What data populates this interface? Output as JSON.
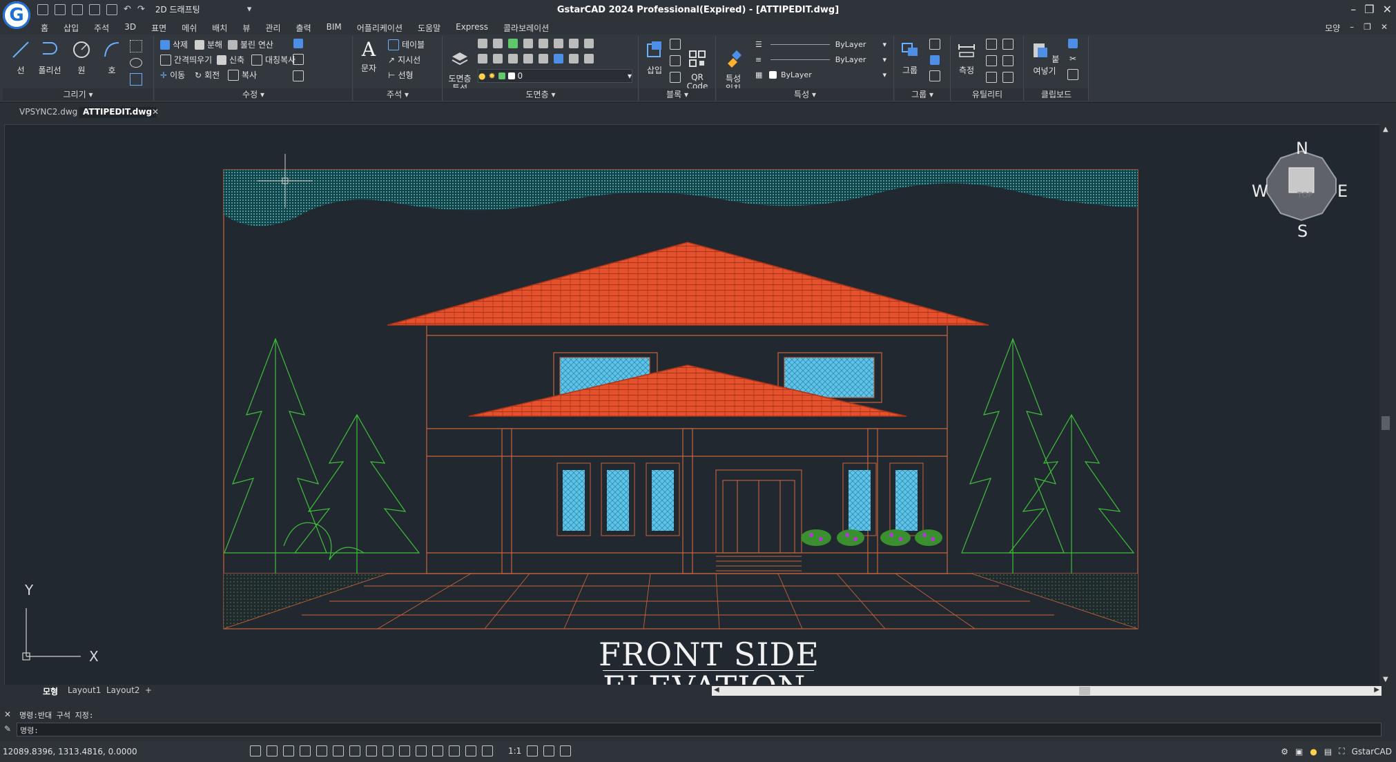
{
  "titlebar": {
    "workspace": "2D 드래프팅",
    "title": "GstarCAD 2024 Professional(Expired) - [ATTIPEDIT.dwg]",
    "logo_letter": "G",
    "controls": [
      "–",
      "❐",
      "✕"
    ]
  },
  "menubar": {
    "items": [
      "홈",
      "삽입",
      "주석",
      "3D",
      "표면",
      "메쉬",
      "배치",
      "뷰",
      "관리",
      "출력",
      "BIM",
      "어플리케이션",
      "도움말",
      "Express",
      "콜라보레이션"
    ],
    "right_label": "모양",
    "right_controls": [
      "–",
      "❐",
      "✕"
    ]
  },
  "ribbon": {
    "draw": {
      "title": "그리기",
      "line": "선",
      "polyline": "폴리선",
      "circle": "원",
      "arc": "호"
    },
    "modify": {
      "title": "수정",
      "erase": "삭제",
      "explode": "분해",
      "boolean": "불린 연산",
      "offset": "간격띄우기",
      "stretch": "신축",
      "mirror": "대칭복사",
      "move": "이동",
      "rotate": "회전",
      "copy": "복사"
    },
    "annotation": {
      "title": "주석",
      "text": "문자",
      "table": "테이블",
      "leader": "지시선",
      "linear": "선형"
    },
    "layers": {
      "title": "도면층",
      "properties": "도면층\n특성",
      "current_layer": "0"
    },
    "block": {
      "title": "블록",
      "insert": "삽입",
      "qr": "QR\nCode"
    },
    "properties": {
      "title": "특성",
      "match": "특성\n일치",
      "color": "ByLayer",
      "linetype": "ByLayer",
      "lineweight": "ByLayer"
    },
    "groups": {
      "title": "그룹",
      "group": "그룹"
    },
    "utilities": {
      "title": "유틸리티",
      "measure": "측정"
    },
    "clipboard": {
      "title": "클립보드",
      "paste": "붙여넣기"
    }
  },
  "doctabs": {
    "tab1": "VPSYNC2.dwg",
    "tab2": "ATTIPEDIT.dwg",
    "close": "✕"
  },
  "drawing": {
    "caption_line1": "FRONT SIDE",
    "caption_line2": "ELEVATION",
    "viewcube": {
      "n": "N",
      "s": "S",
      "e": "E",
      "w": "W",
      "top": "TOP"
    },
    "ucs": {
      "x": "X",
      "y": "Y"
    },
    "colors": {
      "roof": "#e4512c",
      "hatch": "#2fa7a6",
      "trees": "#3fbf3a",
      "outline": "#c8643a",
      "glass": "#5fc5e8"
    }
  },
  "layout_tabs": {
    "model": "모형",
    "layout1": "Layout1",
    "layout2": "Layout2",
    "add": "+"
  },
  "command": {
    "line1": "명령:반대 구석 지정:",
    "line2": "명령:"
  },
  "status": {
    "coords": "12089.8396, 1313.4816, 0.0000",
    "scale": "1:1",
    "brand": "GstarCAD"
  }
}
